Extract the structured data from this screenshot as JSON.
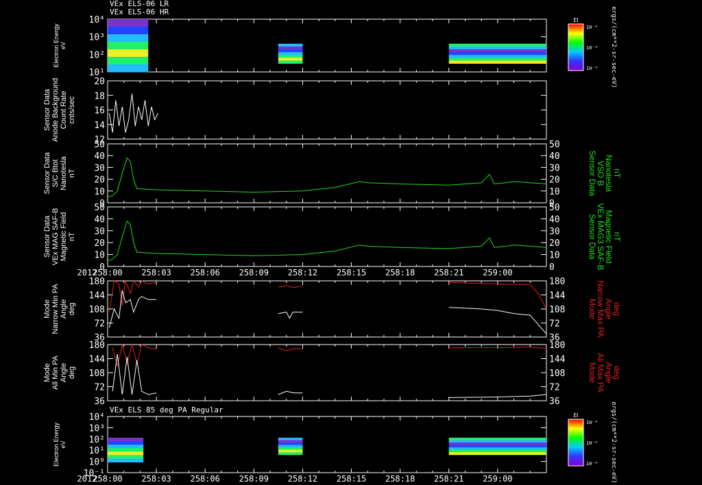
{
  "header": {
    "line1": "VEx ELS-06 LR",
    "line2": "VEx ELS-06 HR"
  },
  "spectrogram2_title": "VEx ELS 85 deg PA Regular",
  "year_label": "2012",
  "x_ticks": [
    "258:00",
    "258:03",
    "258:06",
    "258:09",
    "258:12",
    "258:15",
    "258:18",
    "258:21",
    "259:00"
  ],
  "colors": {
    "white": "#ffffff",
    "green": "#22dd22",
    "red": "#dd2222",
    "background": "#000000"
  },
  "colorbar": {
    "title": "El",
    "ticks_top": [
      "10⁻⁴",
      "10⁻⁶",
      "10⁻⁸"
    ],
    "ticks_bottom": [
      "10⁻⁴",
      "10⁻⁶",
      "10⁻⁸"
    ],
    "unit": "ergs/(cm**2-sr-sec-eV)"
  },
  "chart_data": [
    {
      "type": "heatmap",
      "id": "spec1",
      "ylabel": [
        "Electron Energy",
        "eV"
      ],
      "ytick_labels": [
        "10⁴",
        "10³",
        "10²",
        "10¹"
      ],
      "ylim": [
        1,
        20000
      ],
      "xlim": [
        "258:00",
        "259:00"
      ],
      "blocks": [
        {
          "x": [
            "258:00",
            "258:02.5"
          ],
          "e": [
            1,
            30000
          ],
          "level": "mixed"
        },
        {
          "x": [
            "258:10.5",
            "258:12"
          ],
          "e": [
            5,
            200
          ],
          "level": "mixed"
        },
        {
          "x": [
            "258:21",
            "258:27"
          ],
          "e": [
            5,
            200
          ],
          "level": "mixed"
        }
      ]
    },
    {
      "type": "line",
      "id": "bg",
      "ylabel": [
        "Sensor Data",
        "Anode Background",
        "Count Rate",
        "cnts/sec"
      ],
      "ytick_labels": [
        "20",
        "18",
        "16",
        "14",
        "12"
      ],
      "ylim": [
        11,
        20
      ],
      "xlim": [
        "258:00",
        "259:00"
      ],
      "series": [
        {
          "color": "#ffffff",
          "values": [
            [
              0.1,
              15
            ],
            [
              0.3,
              12
            ],
            [
              0.5,
              17
            ],
            [
              0.7,
              13
            ],
            [
              0.9,
              16
            ],
            [
              1.1,
              12
            ],
            [
              1.3,
              14
            ],
            [
              1.5,
              18
            ],
            [
              1.7,
              13
            ],
            [
              1.9,
              16
            ],
            [
              2.1,
              14
            ],
            [
              2.3,
              17
            ],
            [
              2.5,
              13
            ],
            [
              2.7,
              16
            ],
            [
              2.9,
              14
            ],
            [
              3.1,
              15
            ]
          ]
        }
      ]
    },
    {
      "type": "line",
      "id": "b1",
      "ylabel": [
        "Sensor Data",
        "S/C Btot",
        "Nanotesla",
        "nT"
      ],
      "ylabel_right": [
        "Sensor Data",
        "VSO B",
        "Nanotesla",
        "nT"
      ],
      "ytick_labels": [
        "50",
        "40",
        "30",
        "20",
        "10",
        "0"
      ],
      "ylim": [
        0,
        50
      ],
      "xlim": [
        "258:00",
        "259:00"
      ],
      "series": [
        {
          "color": "#22dd22",
          "values": [
            [
              0,
              5
            ],
            [
              0.3,
              6
            ],
            [
              0.6,
              10
            ],
            [
              0.9,
              25
            ],
            [
              1.2,
              38
            ],
            [
              1.4,
              35
            ],
            [
              1.6,
              20
            ],
            [
              1.8,
              12
            ],
            [
              3,
              11
            ],
            [
              6,
              10
            ],
            [
              9,
              9
            ],
            [
              12,
              10
            ],
            [
              14,
              13
            ],
            [
              15.5,
              18
            ],
            [
              16,
              17
            ],
            [
              18,
              16
            ],
            [
              21,
              15
            ],
            [
              23,
              17
            ],
            [
              23.5,
              24
            ],
            [
              23.8,
              16
            ],
            [
              24.5,
              17
            ],
            [
              25,
              18
            ],
            [
              26,
              17
            ],
            [
              27,
              16
            ]
          ]
        }
      ]
    },
    {
      "type": "line",
      "id": "b2",
      "ylabel": [
        "Sensor Data",
        "VEx MAG SAF-B",
        "Magnetic Field",
        "nT"
      ],
      "ylabel_right": [
        "Sensor Data",
        "VEx MAG3 SAF-B",
        "Magnetic Field",
        "nT"
      ],
      "ytick_labels": [
        "50",
        "40",
        "30",
        "20",
        "10",
        "0"
      ],
      "ylim": [
        0,
        50
      ],
      "xlim": [
        "258:00",
        "259:00"
      ],
      "series": [
        {
          "color": "#22dd22",
          "values": [
            [
              0,
              5
            ],
            [
              0.3,
              6
            ],
            [
              0.6,
              10
            ],
            [
              0.9,
              25
            ],
            [
              1.2,
              38
            ],
            [
              1.4,
              35
            ],
            [
              1.6,
              20
            ],
            [
              1.8,
              12
            ],
            [
              3,
              11
            ],
            [
              6,
              10
            ],
            [
              9,
              9
            ],
            [
              12,
              10
            ],
            [
              14,
              13
            ],
            [
              15.5,
              18
            ],
            [
              16,
              17
            ],
            [
              18,
              16
            ],
            [
              21,
              15
            ],
            [
              23,
              17
            ],
            [
              23.5,
              24
            ],
            [
              23.8,
              16
            ],
            [
              24.5,
              17
            ],
            [
              25,
              18
            ],
            [
              26,
              17
            ],
            [
              27,
              16
            ]
          ]
        }
      ]
    },
    {
      "type": "line",
      "id": "pa1",
      "ylabel": [
        "Mode",
        "Narrow Min PA",
        "Angle",
        "deg"
      ],
      "ylabel_right": [
        "Mode",
        "Narrow Max PA",
        "Angle",
        "deg"
      ],
      "ytick_labels": [
        "180",
        "144",
        "108",
        "72",
        "36"
      ],
      "ylim": [
        0,
        180
      ],
      "xlim": [
        "258:00",
        "259:00"
      ],
      "series": [
        {
          "color": "#dd2222",
          "values": [
            [
              0.1,
              80
            ],
            [
              0.4,
              180
            ],
            [
              0.7,
              170
            ],
            [
              0.9,
              100
            ],
            [
              1.1,
              180
            ],
            [
              1.4,
              140
            ],
            [
              1.6,
              180
            ],
            [
              1.9,
              160
            ],
            [
              2.1,
              180
            ],
            [
              2.5,
              170
            ],
            [
              3,
              175
            ]
          ]
        },
        {
          "color": "#ffffff",
          "values": [
            [
              0.1,
              30
            ],
            [
              0.4,
              90
            ],
            [
              0.7,
              60
            ],
            [
              0.9,
              150
            ],
            [
              1.1,
              110
            ],
            [
              1.4,
              120
            ],
            [
              1.6,
              80
            ],
            [
              1.9,
              120
            ],
            [
              2.1,
              130
            ],
            [
              2.5,
              120
            ],
            [
              3,
              120
            ]
          ]
        },
        {
          "color": "#dd2222",
          "values": [
            [
              10.5,
              160
            ],
            [
              11,
              165
            ],
            [
              11.5,
              158
            ],
            [
              12,
              165
            ]
          ]
        },
        {
          "color": "#ffffff",
          "values": [
            [
              10.5,
              75
            ],
            [
              11,
              80
            ],
            [
              11.2,
              60
            ],
            [
              11.4,
              80
            ],
            [
              12,
              80
            ]
          ]
        },
        {
          "color": "#dd2222",
          "values": [
            [
              21,
              175
            ],
            [
              24,
              170
            ],
            [
              26,
              168
            ],
            [
              26.5,
              140
            ],
            [
              27,
              90
            ]
          ]
        },
        {
          "color": "#ffffff",
          "values": [
            [
              21,
              95
            ],
            [
              23,
              90
            ],
            [
              24,
              85
            ],
            [
              25,
              75
            ],
            [
              26,
              70
            ],
            [
              26.5,
              40
            ],
            [
              27,
              10
            ]
          ]
        }
      ]
    },
    {
      "type": "line",
      "id": "pa2",
      "ylabel": [
        "Mode",
        "All Min PA",
        "Angle",
        "deg"
      ],
      "ylabel_right": [
        "Mode",
        "All Max PA",
        "Angle",
        "deg"
      ],
      "ytick_labels": [
        "180",
        "144",
        "108",
        "72",
        "36"
      ],
      "ylim": [
        0,
        180
      ],
      "xlim": [
        "258:00",
        "259:00"
      ],
      "series": [
        {
          "color": "#dd2222",
          "values": [
            [
              0.3,
              170
            ],
            [
              0.6,
              110
            ],
            [
              0.9,
              180
            ],
            [
              1.2,
              120
            ],
            [
              1.5,
              180
            ],
            [
              1.8,
              120
            ],
            [
              2.1,
              180
            ],
            [
              2.5,
              170
            ],
            [
              3,
              165
            ]
          ]
        },
        {
          "color": "#ffffff",
          "values": [
            [
              0.3,
              30
            ],
            [
              0.6,
              150
            ],
            [
              0.9,
              20
            ],
            [
              1.2,
              140
            ],
            [
              1.5,
              20
            ],
            [
              1.8,
              130
            ],
            [
              2.1,
              30
            ],
            [
              2.5,
              20
            ],
            [
              3,
              25
            ]
          ]
        },
        {
          "color": "#dd2222",
          "values": [
            [
              10.5,
              170
            ],
            [
              11,
              160
            ],
            [
              11.5,
              168
            ],
            [
              12,
              165
            ]
          ]
        },
        {
          "color": "#ffffff",
          "values": [
            [
              10.5,
              20
            ],
            [
              11,
              30
            ],
            [
              11.5,
              25
            ],
            [
              12,
              25
            ]
          ]
        },
        {
          "color": "#dd2222",
          "values": [
            [
              21,
              170
            ],
            [
              24,
              170
            ],
            [
              26,
              172
            ],
            [
              27,
              168
            ]
          ]
        },
        {
          "color": "#ffffff",
          "values": [
            [
              21,
              10
            ],
            [
              24,
              12
            ],
            [
              26,
              15
            ],
            [
              27,
              20
            ]
          ]
        }
      ]
    },
    {
      "type": "heatmap",
      "id": "spec2",
      "ylabel": [
        "Electron Energy",
        "eV"
      ],
      "ytick_labels": [
        "10⁴",
        "10³",
        "10²",
        "10¹",
        "10⁰",
        "10⁻¹"
      ],
      "ylim": [
        0.1,
        20000
      ],
      "xlim": [
        "258:00",
        "259:00"
      ],
      "blocks": [
        {
          "x": [
            "258:00",
            "258:02.2"
          ],
          "e": [
            1,
            200
          ],
          "level": "mixed"
        },
        {
          "x": [
            "258:10.5",
            "258:12"
          ],
          "e": [
            5,
            200
          ],
          "level": "mixed"
        },
        {
          "x": [
            "258:21",
            "258:27"
          ],
          "e": [
            5,
            200
          ],
          "level": "mixed"
        }
      ]
    }
  ]
}
